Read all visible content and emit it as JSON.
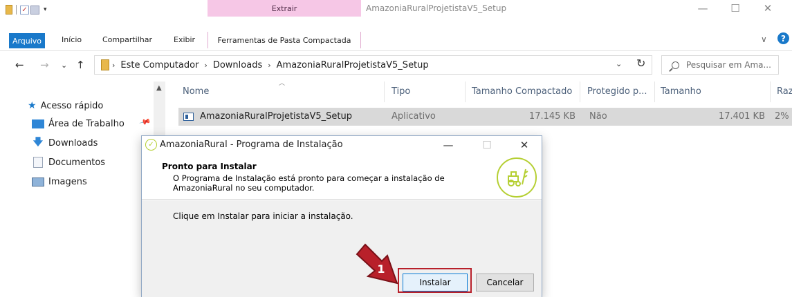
{
  "explorer": {
    "contextual_tab": "Extrair",
    "window_title": "AmazoniaRuralProjetistaV5_Setup",
    "window_controls": {
      "minimize": "—",
      "maximize": "☐",
      "close": "✕"
    },
    "ribbon_tabs": [
      "Arquivo",
      "Início",
      "Compartilhar",
      "Exibir",
      "Ferramentas de Pasta Compactada"
    ],
    "help_chevron": "∨",
    "help_icon_label": "?"
  },
  "address": {
    "crumbs": [
      "Este Computador",
      "Downloads",
      "AmazoniaRuralProjetistaV5_Setup"
    ],
    "separator": "›",
    "nav_buttons": {
      "back": "←",
      "forward": "→",
      "recent": "⌄",
      "up": "↑"
    },
    "dropdown": "⌄",
    "refresh": "↻",
    "search_placeholder": "Pesquisar em Ama..."
  },
  "nav_pane": {
    "items": [
      {
        "label": "Acesso rápido",
        "icon": "star-icon"
      },
      {
        "label": "Área de Trabalho",
        "icon": "desktop-icon"
      },
      {
        "label": "Downloads",
        "icon": "download-arrow-icon"
      },
      {
        "label": "Documentos",
        "icon": "document-icon"
      },
      {
        "label": "Imagens",
        "icon": "pictures-icon"
      }
    ],
    "pin": "📌"
  },
  "file_list": {
    "columns": [
      "Nome",
      "Tipo",
      "Tamanho Compactado",
      "Protegido p...",
      "Tamanho",
      "Raz"
    ],
    "rows": [
      {
        "name": "AmazoniaRuralProjetistaV5_Setup",
        "type": "Aplicativo",
        "compressed_size": "17.145 KB",
        "protected": "Não",
        "size": "17.401 KB",
        "ratio": "2%"
      }
    ]
  },
  "installer": {
    "title": "AmazoniaRural - Programa de Instalação",
    "heading": "Pronto para Instalar",
    "subtext": "O Programa de Instalação está pronto para começar a instalação de AmazoniaRural no seu computador.",
    "body_text": "Clique em Instalar para iniciar a instalação.",
    "install_button": "Instalar",
    "cancel_button": "Cancelar",
    "controls": {
      "minimize": "—",
      "maximize": "☐",
      "close": "✕"
    }
  },
  "callout": {
    "number": "1",
    "color": "#b8202a"
  },
  "colors": {
    "accent": "#1979ca",
    "extract_tab": "#f6c7e6",
    "brand_green": "#b5cf33"
  }
}
